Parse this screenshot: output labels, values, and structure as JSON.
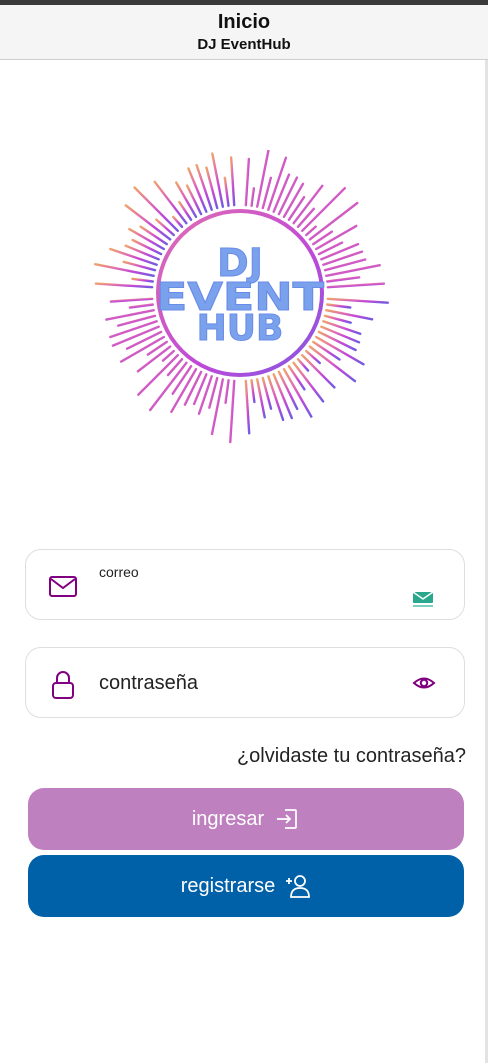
{
  "header": {
    "title": "Inicio",
    "subtitle": "DJ EventHub"
  },
  "logo": {
    "lines": [
      "DJ",
      "EVENT",
      "HUB"
    ],
    "colors": [
      "#f0a26a",
      "#e06fb0",
      "#c048d8",
      "#7f5ae0",
      "#6a8be8"
    ]
  },
  "form": {
    "email": {
      "label": "correo",
      "icon": "mail-icon",
      "extension_icon": "temp-mail-icon"
    },
    "password": {
      "placeholder": "contraseña",
      "icon": "lock-icon",
      "toggle_icon": "eye-icon"
    },
    "forgot_password": "¿olvidaste tu contraseña?"
  },
  "buttons": {
    "login": {
      "label": "ingresar",
      "icon": "login-icon",
      "color": "#bf80bf"
    },
    "register": {
      "label": "registrarse",
      "icon": "add-user-icon",
      "color": "#0061a8"
    }
  },
  "accent_color": "#800080"
}
